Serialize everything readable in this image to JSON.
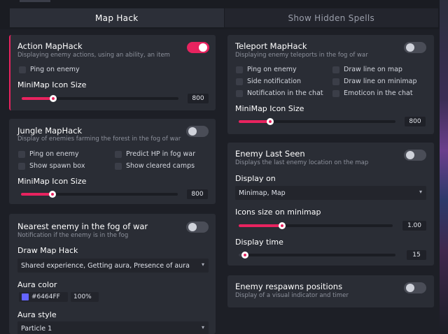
{
  "tabs": [
    {
      "label": "Map Hack",
      "active": true
    },
    {
      "label": "Show Hidden Spells",
      "active": false
    }
  ],
  "accent_color": "#E8235F",
  "left": {
    "action": {
      "title": "Action MapHack",
      "desc": "Displaying enemy actions, using an ability, an item",
      "enabled": true,
      "checks": [
        "Ping on enemy"
      ],
      "slider_label": "MiniMap Icon Size",
      "slider_value": "800",
      "slider_fraction": 0.2
    },
    "jungle": {
      "title": "Jungle MapHack",
      "desc": "Display of enemies farming the forest in the fog of war",
      "enabled": false,
      "checks": [
        "Ping on enemy",
        "Predict HP in fog war",
        "Show spawn box",
        "Show cleared camps"
      ],
      "slider_label": "MiniMap Icon Size",
      "slider_value": "800",
      "slider_fraction": 0.2
    },
    "nearest": {
      "title": "Nearest enemy in the fog of war",
      "desc": "Notification if the enemy is in the fog",
      "enabled": false,
      "draw_label": "Draw Map Hack",
      "draw_value": "Shared experience, Getting aura, Presence of aura",
      "aura_color_label": "Aura color",
      "aura_color_hex": "#6464FF",
      "aura_opacity": "100%",
      "aura_style_label": "Aura style",
      "aura_style_value": "Particle 1"
    }
  },
  "right": {
    "teleport": {
      "title": "Teleport MapHack",
      "desc": "Displaying enemy teleports in the fog of war",
      "enabled": false,
      "checks": [
        "Ping on enemy",
        "Draw line on map",
        "Side notification",
        "Draw line on minimap",
        "Notification in the chat",
        "Emoticon in the chat"
      ],
      "slider_label": "MiniMap Icon Size",
      "slider_value": "800",
      "slider_fraction": 0.2
    },
    "last_seen": {
      "title": "Enemy Last Seen",
      "desc": "Displays the last enemy location on the map",
      "enabled": false,
      "display_on_label": "Display on",
      "display_on_value": "Minimap, Map",
      "icons_size_label": "Icons size on minimap",
      "icons_size_value": "1.00",
      "icons_size_fraction": 0.28,
      "display_time_label": "Display time",
      "display_time_value": "15",
      "display_time_fraction": 0.04
    },
    "respawns": {
      "title": "Enemy respawns positions",
      "desc": "Display of a visual indicator and timer",
      "enabled": false
    }
  },
  "icons": {
    "dropdown": "chevron-down-icon"
  }
}
